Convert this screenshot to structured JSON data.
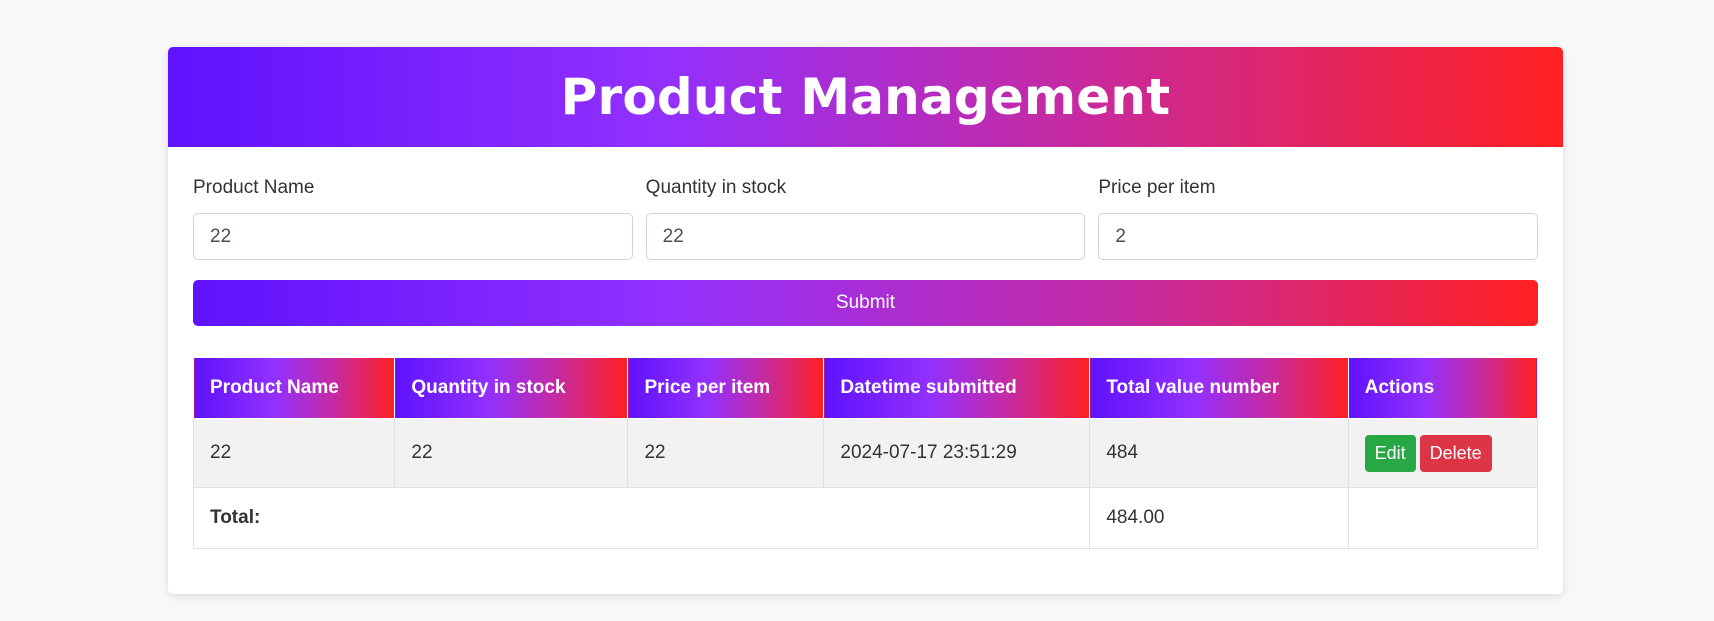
{
  "header": {
    "title": "Product Management"
  },
  "form": {
    "fields": [
      {
        "label": "Product Name",
        "value": "22"
      },
      {
        "label": "Quantity in stock",
        "value": "22"
      },
      {
        "label": "Price per item",
        "value": "2"
      }
    ],
    "submit_label": "Submit"
  },
  "table": {
    "columns": [
      "Product Name",
      "Quantity in stock",
      "Price per item",
      "Datetime submitted",
      "Total value number",
      "Actions"
    ],
    "rows": [
      {
        "product_name": "22",
        "quantity": "22",
        "price": "22",
        "datetime": "2024-07-17 23:51:29",
        "total_value": "484",
        "edit_label": "Edit",
        "delete_label": "Delete"
      }
    ],
    "total_label": "Total:",
    "total_value": "484.00"
  },
  "colors": {
    "gradient_start": "#5f12fd",
    "gradient_mid": "#9230ff",
    "gradient_end": "#ff2020",
    "edit_button": "#28a745",
    "delete_button": "#dc3545"
  }
}
